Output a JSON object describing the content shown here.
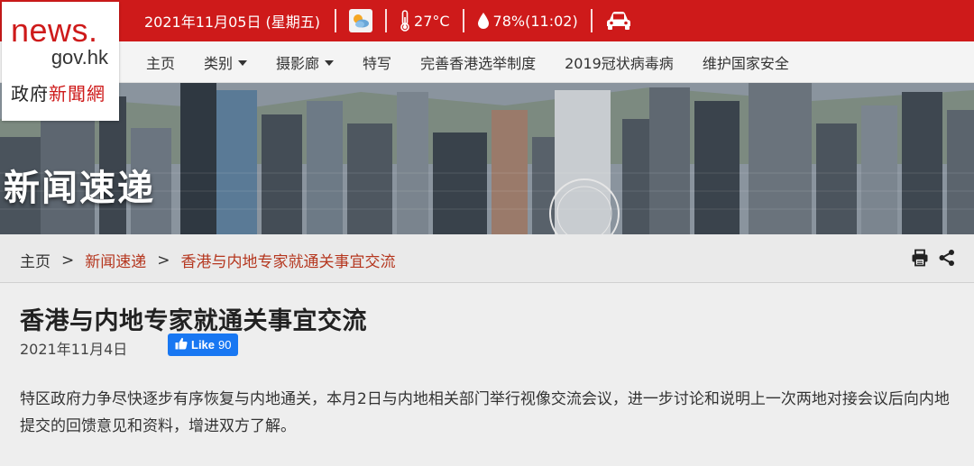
{
  "topbar": {
    "date": "2021年11月05日 (星期五)",
    "weather_icon": "sun-cloud-icon",
    "temperature": "27°C",
    "humidity": "78%(11:02)",
    "traffic_icon": "car-icon"
  },
  "logo": {
    "news": "news.",
    "gov": "gov.hk",
    "zh_part1": "政府",
    "zh_part2": "新聞網"
  },
  "nav": {
    "items": [
      {
        "label": "主页"
      },
      {
        "label": "类别"
      },
      {
        "label": "摄影廊"
      },
      {
        "label": "特写"
      },
      {
        "label": "完善香港选举制度"
      },
      {
        "label": "2019冠状病毒病"
      },
      {
        "label": "维护国家安全"
      }
    ]
  },
  "hero": {
    "title": "新闻速递"
  },
  "breadcrumb": {
    "home": "主页",
    "section": "新闻速递",
    "current": "香港与内地专家就通关事宜交流"
  },
  "article": {
    "title": "香港与内地专家就通关事宜交流",
    "date": "2021年11月4日",
    "like_label": "Like",
    "like_count": "90",
    "body": "特区政府力争尽快逐步有序恢复与内地通关，本月2日与内地相关部门举行视像交流会议，进一步讨论和说明上一次两地对接会议后向内地提交的回馈意见和资料，增进双方了解。"
  },
  "colors": {
    "brand_red": "#ce1a1a",
    "link_red": "#b5371f",
    "facebook_blue": "#1877f2"
  }
}
